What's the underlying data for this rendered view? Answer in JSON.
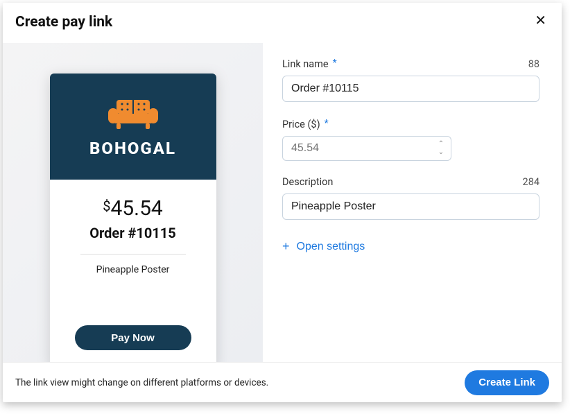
{
  "header": {
    "title": "Create pay link"
  },
  "preview": {
    "brand": "BOHOGAL",
    "currency_symbol": "$",
    "price": "45.54",
    "order": "Order #10115",
    "description": "Pineapple Poster",
    "pay_label": "Pay Now"
  },
  "form": {
    "link_name": {
      "label": "Link name",
      "required": true,
      "value": "Order #10115",
      "counter": "88"
    },
    "price": {
      "label": "Price ($)",
      "required": true,
      "placeholder": "45.54"
    },
    "description": {
      "label": "Description",
      "required": false,
      "value": "Pineapple Poster",
      "counter": "284"
    },
    "open_settings_label": "Open settings"
  },
  "footer": {
    "note": "The link view might change on different platforms or devices.",
    "create_label": "Create Link"
  }
}
